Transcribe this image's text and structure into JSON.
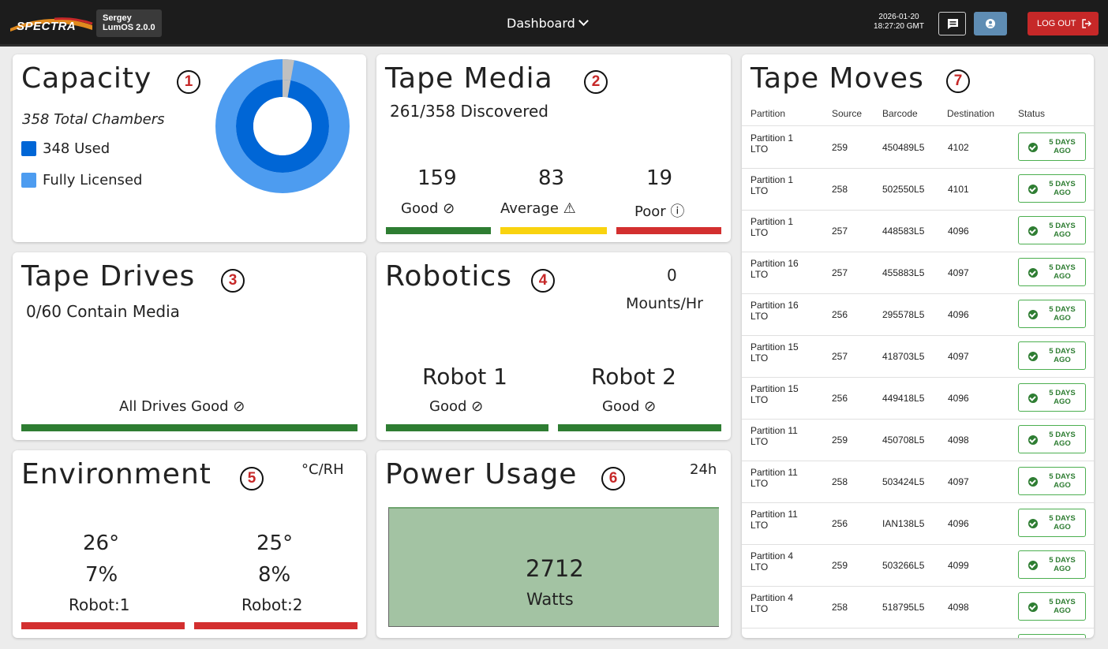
{
  "topbar": {
    "logo_text": "SPECTRA",
    "user_name": "Sergey",
    "version": "LumOS 2.0.0",
    "nav_label": "Dashboard",
    "date": "2026-01-20",
    "time": "18:27:20 GMT",
    "logout_label": "LOG OUT"
  },
  "capacity": {
    "title": "Capacity",
    "number": "1",
    "total": "358 Total Chambers",
    "used": "348 Used",
    "licensed": "Fully Licensed",
    "used_fraction": 0.972,
    "colors": {
      "used": "#0066d6",
      "licensed": "#4d9cf0",
      "free": "#c0c0c0"
    }
  },
  "tape_media": {
    "title": "Tape Media",
    "number": "2",
    "discovered": "261/358 Discovered",
    "good_value": "159",
    "good_label": "Good",
    "average_value": "83",
    "average_label": "Average",
    "poor_value": "19",
    "poor_label": "Poor"
  },
  "tape_drives": {
    "title": "Tape Drives",
    "number": "3",
    "contain": "0/60 Contain Media",
    "status": "All Drives Good"
  },
  "robotics": {
    "title": "Robotics",
    "number": "4",
    "mounts_value": "0",
    "mounts_unit": "Mounts/Hr",
    "robot1_name": "Robot 1",
    "robot1_status": "Good",
    "robot2_name": "Robot 2",
    "robot2_status": "Good"
  },
  "environment": {
    "title": "Environment",
    "number": "5",
    "unit": "°C/RH",
    "r1_temp": "26°",
    "r1_rh": "7%",
    "r1_label": "Robot:1",
    "r2_temp": "25°",
    "r2_rh": "8%",
    "r2_label": "Robot:2"
  },
  "power": {
    "title": "Power Usage",
    "number": "6",
    "period": "24h",
    "value": "2712",
    "unit": "Watts",
    "fill_color": "#a3c3a3"
  },
  "tape_moves": {
    "title": "Tape Moves",
    "number": "7",
    "headers": {
      "partition": "Partition",
      "source": "Source",
      "barcode": "Barcode",
      "destination": "Destination",
      "status": "Status"
    },
    "rows": [
      {
        "partition": "Partition 1 LTO",
        "source": "259",
        "barcode": "450489L5",
        "destination": "4102",
        "status_line1": "5 DAYS",
        "status_line2": "AGO"
      },
      {
        "partition": "Partition 1 LTO",
        "source": "258",
        "barcode": "502550L5",
        "destination": "4101",
        "status_line1": "5 DAYS",
        "status_line2": "AGO"
      },
      {
        "partition": "Partition 1 LTO",
        "source": "257",
        "barcode": "448583L5",
        "destination": "4096",
        "status_line1": "5 DAYS",
        "status_line2": "AGO"
      },
      {
        "partition": "Partition 16 LTO",
        "source": "257",
        "barcode": "455883L5",
        "destination": "4097",
        "status_line1": "5 DAYS",
        "status_line2": "AGO"
      },
      {
        "partition": "Partition 16 LTO",
        "source": "256",
        "barcode": "295578L5",
        "destination": "4096",
        "status_line1": "5 DAYS",
        "status_line2": "AGO"
      },
      {
        "partition": "Partition 15 LTO",
        "source": "257",
        "barcode": "418703L5",
        "destination": "4097",
        "status_line1": "5 DAYS",
        "status_line2": "AGO"
      },
      {
        "partition": "Partition 15 LTO",
        "source": "256",
        "barcode": "449418L5",
        "destination": "4096",
        "status_line1": "5 DAYS",
        "status_line2": "AGO"
      },
      {
        "partition": "Partition 11 LTO",
        "source": "259",
        "barcode": "450708L5",
        "destination": "4098",
        "status_line1": "5 DAYS",
        "status_line2": "AGO"
      },
      {
        "partition": "Partition 11 LTO",
        "source": "258",
        "barcode": "503424L5",
        "destination": "4097",
        "status_line1": "5 DAYS",
        "status_line2": "AGO"
      },
      {
        "partition": "Partition 11 LTO",
        "source": "256",
        "barcode": "IAN138L5",
        "destination": "4096",
        "status_line1": "5 DAYS",
        "status_line2": "AGO"
      },
      {
        "partition": "Partition 4 LTO",
        "source": "259",
        "barcode": "503266L5",
        "destination": "4099",
        "status_line1": "5 DAYS",
        "status_line2": "AGO"
      },
      {
        "partition": "Partition 4 LTO",
        "source": "258",
        "barcode": "518795L5",
        "destination": "4098",
        "status_line1": "5 DAYS",
        "status_line2": "AGO"
      }
    ]
  }
}
